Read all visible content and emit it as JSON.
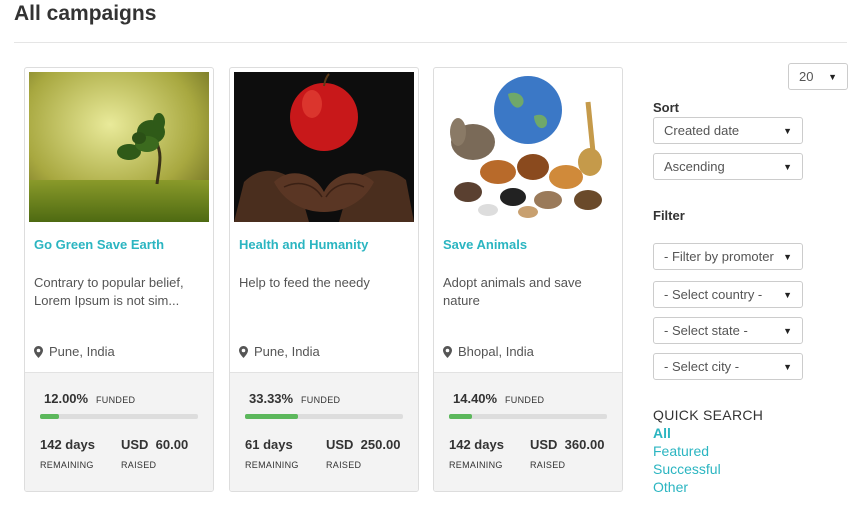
{
  "page": {
    "title": "All campaigns"
  },
  "campaigns": [
    {
      "title": "Go Green Save Earth",
      "description": "Contrary to popular belief, Lorem Ipsum is not sim...",
      "location": "Pune, India",
      "funded_pct": "12.00%",
      "funded_value": 0.12,
      "funded_label": "FUNDED",
      "days": "142 days",
      "remaining_label": "REMAINING",
      "raised_amount": "USD  60.00",
      "raised_label": "RAISED"
    },
    {
      "title": "Health and Humanity",
      "description": "Help to feed the needy",
      "location": "Pune, India",
      "funded_pct": "33.33%",
      "funded_value": 0.3333,
      "funded_label": "FUNDED",
      "days": "61 days",
      "remaining_label": "REMAINING",
      "raised_amount": "USD  250.00",
      "raised_label": "RAISED"
    },
    {
      "title": "Save Animals",
      "description": "Adopt animals and save nature",
      "location": "Bhopal, India",
      "funded_pct": "14.40%",
      "funded_value": 0.144,
      "funded_label": "FUNDED",
      "days": "142 days",
      "remaining_label": "REMAINING",
      "raised_amount": "USD  360.00",
      "raised_label": "RAISED"
    }
  ],
  "sidebar": {
    "per_page": "20",
    "sort_heading": "Sort",
    "sort_by": "Created date",
    "sort_order": "Ascending",
    "filter_heading": "Filter",
    "filter_promoter": "- Filter by promoter",
    "filter_country": "- Select country -",
    "filter_state": "- Select state -",
    "filter_city": "- Select city -",
    "quick_search": {
      "title": "QUICK SEARCH",
      "links": [
        "All",
        "Featured",
        "Successful",
        "Other"
      ]
    }
  },
  "colors": {
    "accent": "#2bb5c1",
    "progress": "#5cb85c"
  },
  "icons": {
    "location": "map-marker-icon",
    "caret": "caret-down-icon"
  }
}
